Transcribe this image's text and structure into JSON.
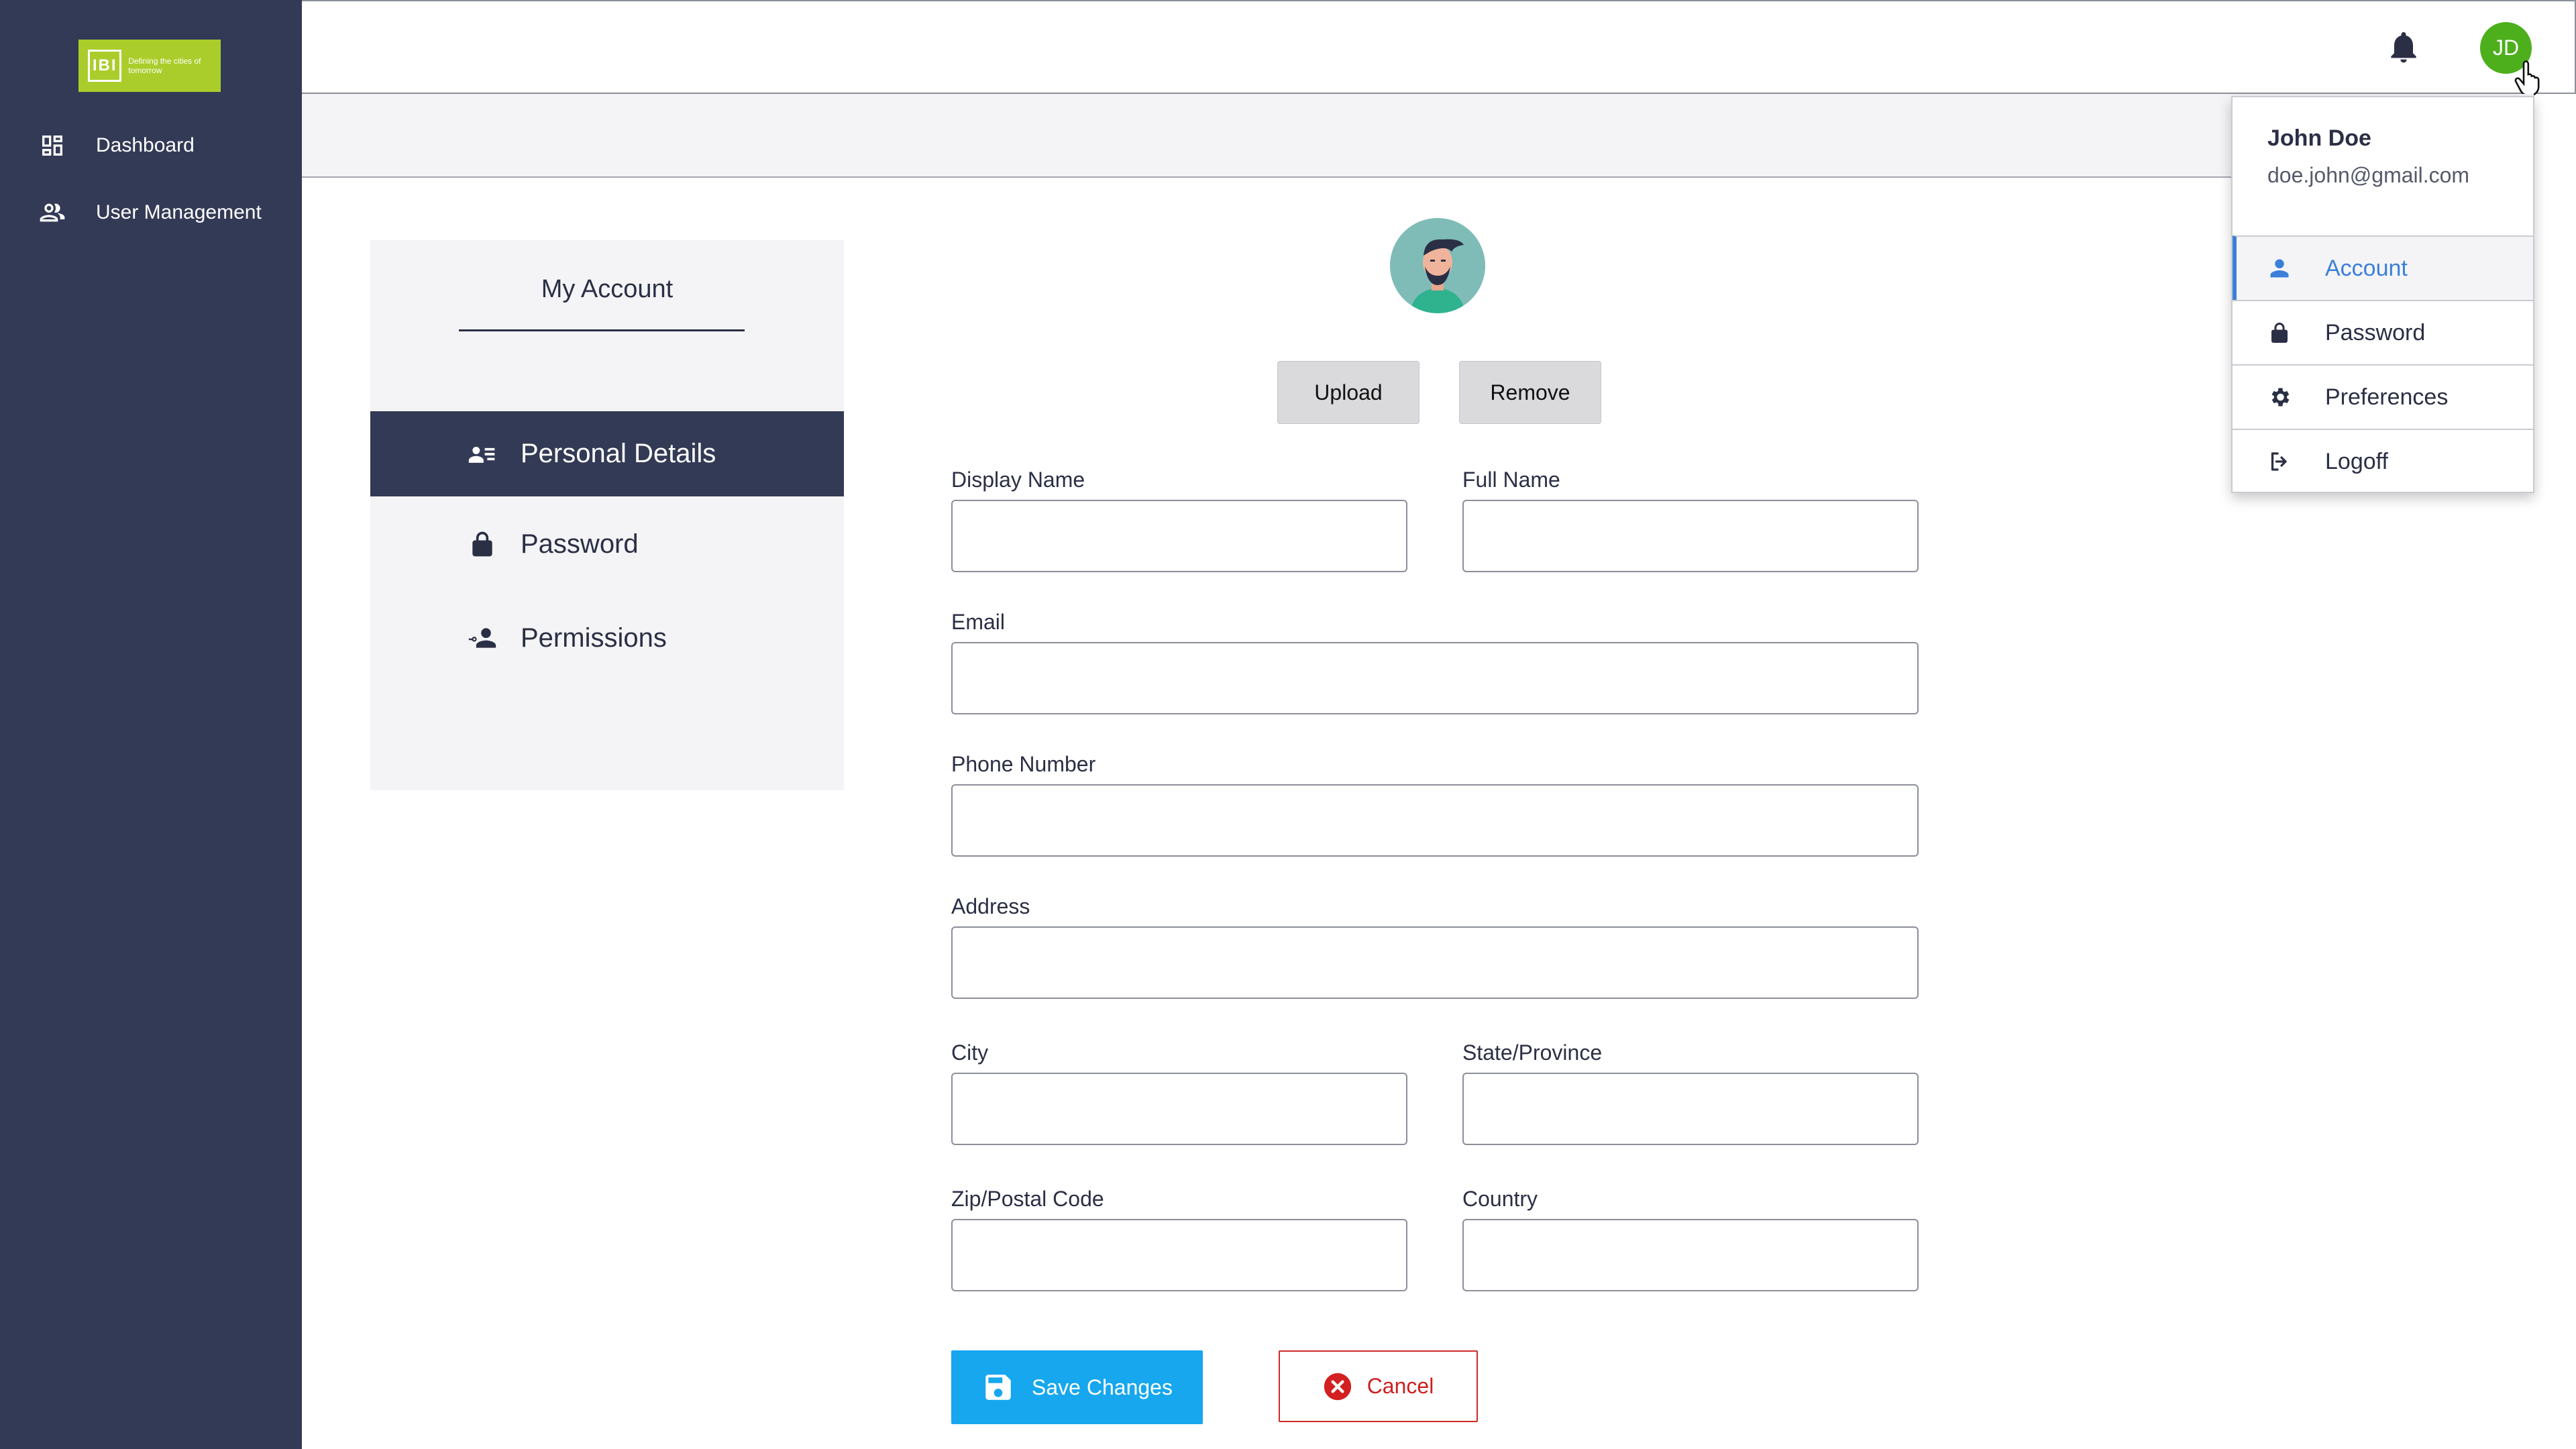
{
  "app": {
    "logo_text": "IBI",
    "logo_tagline": "Defining the cities of tomorrow"
  },
  "sidebar": {
    "items": [
      {
        "label": "Dashboard",
        "icon": "dashboard-icon"
      },
      {
        "label": "User Management",
        "icon": "users-icon"
      }
    ]
  },
  "topbar": {
    "avatar_initials": "JD",
    "avatar_color": "#4caf1b"
  },
  "account_menu": {
    "title": "My Account",
    "tabs": [
      {
        "label": "Personal Details",
        "icon": "personal-details-icon",
        "active": true
      },
      {
        "label": "Password",
        "icon": "lock-icon"
      },
      {
        "label": "Permissions",
        "icon": "permissions-icon"
      }
    ]
  },
  "profile": {
    "upload_label": "Upload",
    "remove_label": "Remove"
  },
  "form": {
    "display_name_label": "Display Name",
    "full_name_label": "Full Name",
    "email_label": "Email",
    "phone_label": "Phone Number",
    "address_label": "Address",
    "city_label": "City",
    "state_label": "State/Province",
    "zip_label": "Zip/Postal Code",
    "country_label": "Country",
    "display_name_value": "",
    "full_name_value": "",
    "email_value": "",
    "phone_value": "",
    "address_value": "",
    "city_value": "",
    "state_value": "",
    "zip_value": "",
    "country_value": "",
    "save_label": "Save Changes",
    "cancel_label": "Cancel"
  },
  "dropdown": {
    "name": "John Doe",
    "email": "doe.john@gmail.com",
    "items": [
      {
        "label": "Account",
        "icon": "user-icon",
        "active": true
      },
      {
        "label": "Password",
        "icon": "lock-icon"
      },
      {
        "label": "Preferences",
        "icon": "gear-icon"
      },
      {
        "label": "Logoff",
        "icon": "logout-icon"
      }
    ]
  },
  "colors": {
    "sidebar": "#333a55",
    "accent": "#3b7fd9",
    "save": "#16a7ee",
    "cancel": "#cc1f1f",
    "logo": "#aacd2b"
  }
}
